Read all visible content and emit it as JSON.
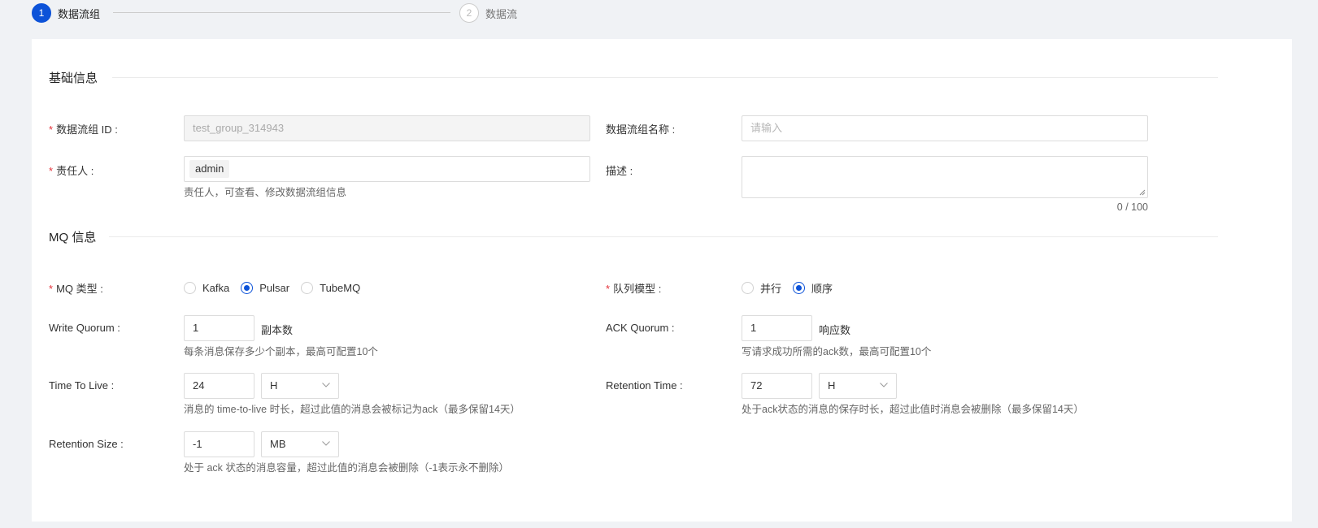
{
  "steps": [
    {
      "number": "1",
      "label": "数据流组"
    },
    {
      "number": "2",
      "label": "数据流"
    }
  ],
  "sections": {
    "basic": "基础信息",
    "mq": "MQ 信息"
  },
  "basic": {
    "group_id_label": "数据流组 ID",
    "group_id_value": "test_group_314943",
    "group_name_label": "数据流组名称",
    "group_name_placeholder": "请输入",
    "owner_label": "责任人",
    "owner_tag": "admin",
    "owner_hint": "责任人，可查看、修改数据流组信息",
    "desc_label": "描述",
    "desc_counter": "0 / 100"
  },
  "mq": {
    "mq_type_label": "MQ 类型",
    "mq_type_options": [
      "Kafka",
      "Pulsar",
      "TubeMQ"
    ],
    "mq_type_selected": "Pulsar",
    "queue_model_label": "队列模型",
    "queue_model_options": [
      "并行",
      "顺序"
    ],
    "queue_model_selected": "顺序",
    "write_quorum_label": "Write Quorum",
    "write_quorum_value": "1",
    "write_quorum_unit": "副本数",
    "write_quorum_hint": "每条消息保存多少个副本，最高可配置10个",
    "ack_quorum_label": "ACK Quorum",
    "ack_quorum_value": "1",
    "ack_quorum_unit": "响应数",
    "ack_quorum_hint": "写请求成功所需的ack数，最高可配置10个",
    "ttl_label": "Time To Live",
    "ttl_value": "24",
    "ttl_unit": "H",
    "ttl_hint": "消息的 time-to-live 时长，超过此值的消息会被标记为ack（最多保留14天）",
    "retention_time_label": "Retention Time",
    "retention_time_value": "72",
    "retention_time_unit": "H",
    "retention_time_hint": "处于ack状态的消息的保存时长，超过此值时消息会被删除（最多保留14天）",
    "retention_size_label": "Retention Size",
    "retention_size_value": "-1",
    "retention_size_unit": "MB",
    "retention_size_hint": "处于 ack 状态的消息容量，超过此值的消息会被删除（-1表示永不删除）"
  },
  "colors": {
    "primary": "#0c52d8",
    "required": "#e5323a"
  }
}
